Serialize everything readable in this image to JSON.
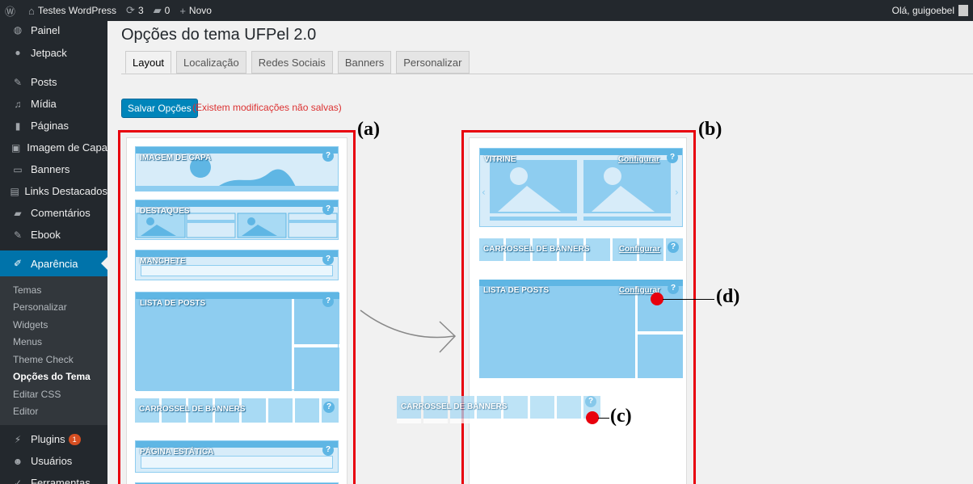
{
  "adminbar": {
    "wp_logo": "wp-icon",
    "site_icon": "home-icon",
    "site_name": "Testes WordPress",
    "updates_icon": "refresh-icon",
    "updates_count": "3",
    "comments_icon": "comment-icon",
    "comments_count": "0",
    "new_icon": "plus-icon",
    "new_label": "Novo",
    "greeting": "Olá, guigoebel"
  },
  "sidebar": {
    "items": [
      {
        "label": "Painel",
        "icon": "dashboard-icon"
      },
      {
        "label": "Jetpack",
        "icon": "jetpack-icon"
      },
      {
        "label": "Posts",
        "icon": "pin-icon"
      },
      {
        "label": "Mídia",
        "icon": "media-icon"
      },
      {
        "label": "Páginas",
        "icon": "pages-icon"
      },
      {
        "label": "Imagem de Capa",
        "icon": "image-icon"
      },
      {
        "label": "Banners",
        "icon": "banner-icon"
      },
      {
        "label": "Links Destacados",
        "icon": "links-icon"
      },
      {
        "label": "Comentários",
        "icon": "comment-icon"
      },
      {
        "label": "Ebook",
        "icon": "pin-icon"
      }
    ],
    "current": {
      "label": "Aparência",
      "icon": "brush-icon"
    },
    "submenu": [
      "Temas",
      "Personalizar",
      "Widgets",
      "Menus",
      "Theme Check",
      "Opções do Tema",
      "Editar CSS",
      "Editor"
    ],
    "active_submenu": "Opções do Tema",
    "after": [
      {
        "label": "Plugins",
        "icon": "plugin-icon",
        "badge": "1"
      },
      {
        "label": "Usuários",
        "icon": "users-icon"
      },
      {
        "label": "Ferramentas",
        "icon": "tools-icon"
      }
    ]
  },
  "main": {
    "title": "Opções do tema UFPel 2.0",
    "tabs": [
      "Layout",
      "Localização",
      "Redes Sociais",
      "Banners",
      "Personalizar"
    ],
    "active_tab": "Layout",
    "save_button": "Salvar Opções",
    "unsaved_note": "(Existem modificações não salvas)"
  },
  "column_a": {
    "widgets": [
      {
        "label": "IMAGEM DE CAPA"
      },
      {
        "label": "DESTAQUES"
      },
      {
        "label": "MANCHETE"
      },
      {
        "label": "LISTA DE POSTS"
      },
      {
        "label": "CARROSSEL DE BANNERS"
      },
      {
        "label": "PÁGINA ESTÁTICA"
      }
    ]
  },
  "column_b": {
    "widgets": [
      {
        "label": "VITRINE",
        "configure": "Configurar"
      },
      {
        "label": "CARROSSEL DE BANNERS",
        "configure": "Configurar"
      },
      {
        "label": "LISTA DE POSTS",
        "configure": "Configurar"
      }
    ]
  },
  "dragged_widget": {
    "label": "CARROSSEL DE BANNERS"
  },
  "help_mark": "?",
  "annotations": [
    "(a)",
    "(b)",
    "(c)",
    "(d)"
  ],
  "colors": {
    "highlight": "#e8000d",
    "accent": "#0073aa",
    "widget": "#8ecdf0"
  }
}
